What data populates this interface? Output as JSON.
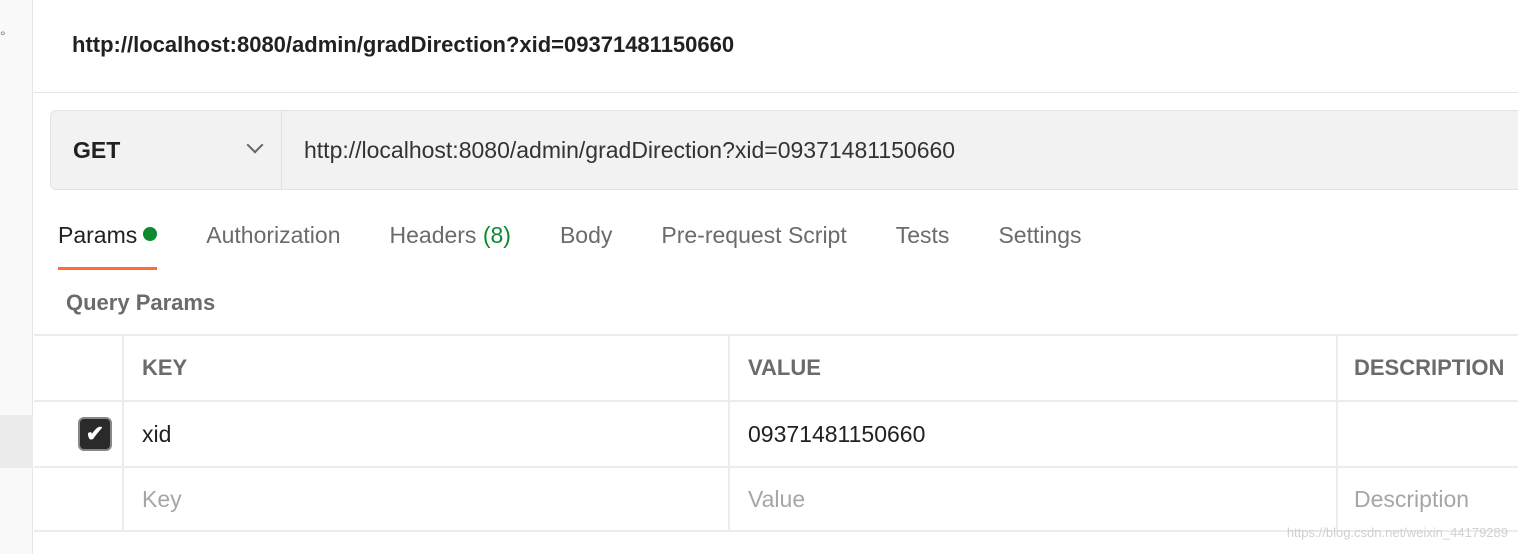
{
  "window": {
    "title": "http://localhost:8080/admin/gradDirection?xid=09371481150660",
    "sidebar_glyph": "°"
  },
  "request": {
    "method": "GET",
    "url": "http://localhost:8080/admin/gradDirection?xid=09371481150660"
  },
  "tabs": [
    {
      "label": "Params",
      "active": true,
      "indicator": "green-dot"
    },
    {
      "label": "Authorization"
    },
    {
      "label": "Headers",
      "count": "(8)"
    },
    {
      "label": "Body"
    },
    {
      "label": "Pre-request Script"
    },
    {
      "label": "Tests"
    },
    {
      "label": "Settings"
    }
  ],
  "query_params": {
    "title": "Query Params",
    "headers": [
      "KEY",
      "VALUE",
      "DESCRIPTION"
    ],
    "rows": [
      {
        "checked": true,
        "key": "xid",
        "value": "09371481150660",
        "description": ""
      }
    ],
    "placeholders": {
      "key": "Key",
      "value": "Value",
      "description": "Description"
    }
  },
  "watermark": "https://blog.csdn.net/weixin_44179289",
  "colors": {
    "accent": "#ff6c37",
    "success": "#0b8a2f"
  }
}
